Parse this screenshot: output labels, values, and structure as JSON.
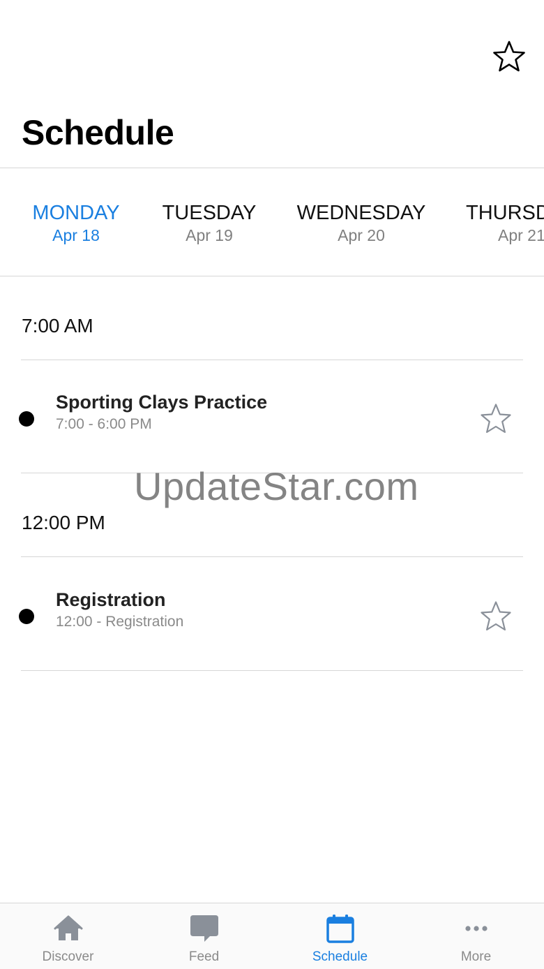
{
  "header": {
    "title": "Schedule",
    "favorite_icon": "star-outline-icon"
  },
  "days": [
    {
      "dow": "MONDAY",
      "date": "Apr 18",
      "active": true
    },
    {
      "dow": "TUESDAY",
      "date": "Apr 19",
      "active": false
    },
    {
      "dow": "WEDNESDAY",
      "date": "Apr 20",
      "active": false
    },
    {
      "dow": "THURSDAY",
      "date": "Apr 21",
      "active": false
    }
  ],
  "time_groups": [
    {
      "time": "7:00 AM",
      "sessions": [
        {
          "title": "Sporting Clays Practice",
          "subtitle": "7:00 - 6:00 PM"
        }
      ]
    },
    {
      "time": "12:00 PM",
      "sessions": [
        {
          "title": "Registration",
          "subtitle": "12:00 - Registration"
        }
      ]
    }
  ],
  "watermark": "UpdateStar.com",
  "tabbar": {
    "items": [
      {
        "label": "Discover",
        "icon": "home-icon",
        "active": false
      },
      {
        "label": "Feed",
        "icon": "speech-bubble-icon",
        "active": false
      },
      {
        "label": "Schedule",
        "icon": "calendar-icon",
        "active": true
      },
      {
        "label": "More",
        "icon": "more-dots-icon",
        "active": false
      }
    ]
  },
  "colors": {
    "accent": "#1a7fe0",
    "inactive": "#8a8a8a",
    "divider": "#d6d6d6"
  }
}
